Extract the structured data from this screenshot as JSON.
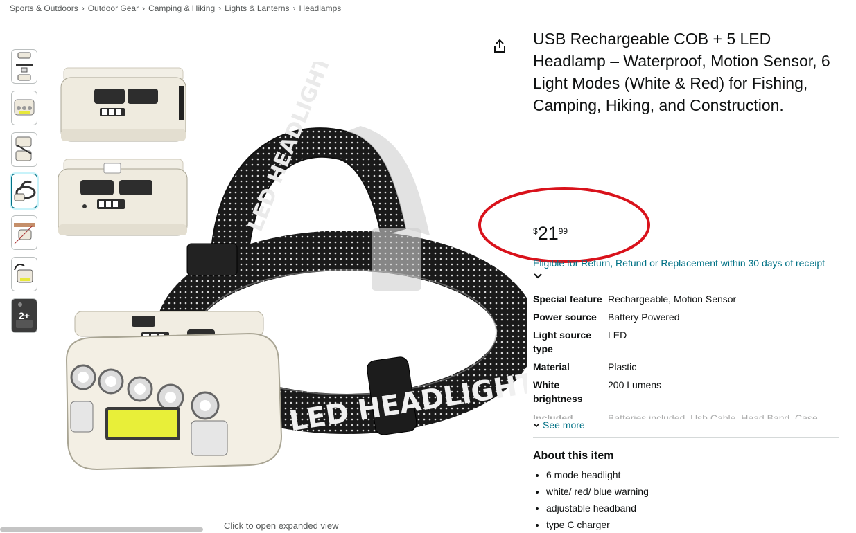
{
  "breadcrumb": [
    "Sports & Outdoors",
    "Outdoor Gear",
    "Camping & Hiking",
    "Lights & Lanterns",
    "Headlamps"
  ],
  "breadcrumb_separator": "›",
  "thumbnails": {
    "more_count": "2+"
  },
  "main_image": {
    "expand_hint": "Click to open expanded view",
    "strap_text": "LED HEADLIGHT"
  },
  "product": {
    "title": "USB Rechargeable COB + 5 LED Headlamp – Waterproof, Motion Sensor, 6 Light Modes (White & Red) for Fishing, Camping, Hiking, and Construction.",
    "price_symbol": "$",
    "price_whole": "21",
    "price_fraction": "99",
    "return_policy": "Eligible for Return, Refund or Replacement within 30 days of receipt"
  },
  "specs": [
    {
      "key": "Special feature",
      "value": "Rechargeable, Motion Sensor"
    },
    {
      "key": "Power source",
      "value": "Battery Powered"
    },
    {
      "key": "Light source type",
      "value": "LED"
    },
    {
      "key": "Material",
      "value": "Plastic"
    },
    {
      "key": "White brightness",
      "value": "200 Lumens"
    }
  ],
  "specs_partial": {
    "key": "Included",
    "value": "Batteries included, Usb Cable, Head Band, Case"
  },
  "see_more": "See more",
  "about": {
    "heading": "About this item",
    "bullets": [
      "6 mode headlight",
      "white/ red/ blue warning",
      "adjustable headband",
      "type C charger"
    ]
  },
  "colors": {
    "link": "#007185",
    "annotation": "#d9121b",
    "text": "#0f1111",
    "muted": "#565959"
  }
}
